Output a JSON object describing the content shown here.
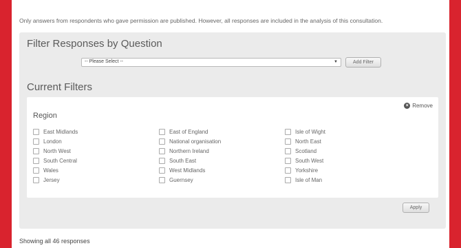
{
  "notice": "Only answers from respondents who gave permission are published. However, all responses are included in the analysis of this consultation.",
  "filter": {
    "heading": "Filter Responses by Question",
    "select_value": "-- Please Select --",
    "add_label": "Add Filter"
  },
  "current": {
    "heading": "Current Filters",
    "group_title": "Region",
    "remove_label": "Remove",
    "columns": [
      [
        "East Midlands",
        "London",
        "North West",
        "South Central",
        "Wales",
        "Jersey"
      ],
      [
        "East of England",
        "National organisation",
        "Northern Ireland",
        "South East",
        "West Midlands",
        "Guernsey"
      ],
      [
        "Isle of Wight",
        "North East",
        "Scotland",
        "South West",
        "Yorkshire",
        "Isle of Man"
      ]
    ],
    "apply_label": "Apply"
  },
  "showing": "Showing all 46 responses",
  "colors": {
    "frame": "#d9232e",
    "panel": "#ebebeb"
  }
}
